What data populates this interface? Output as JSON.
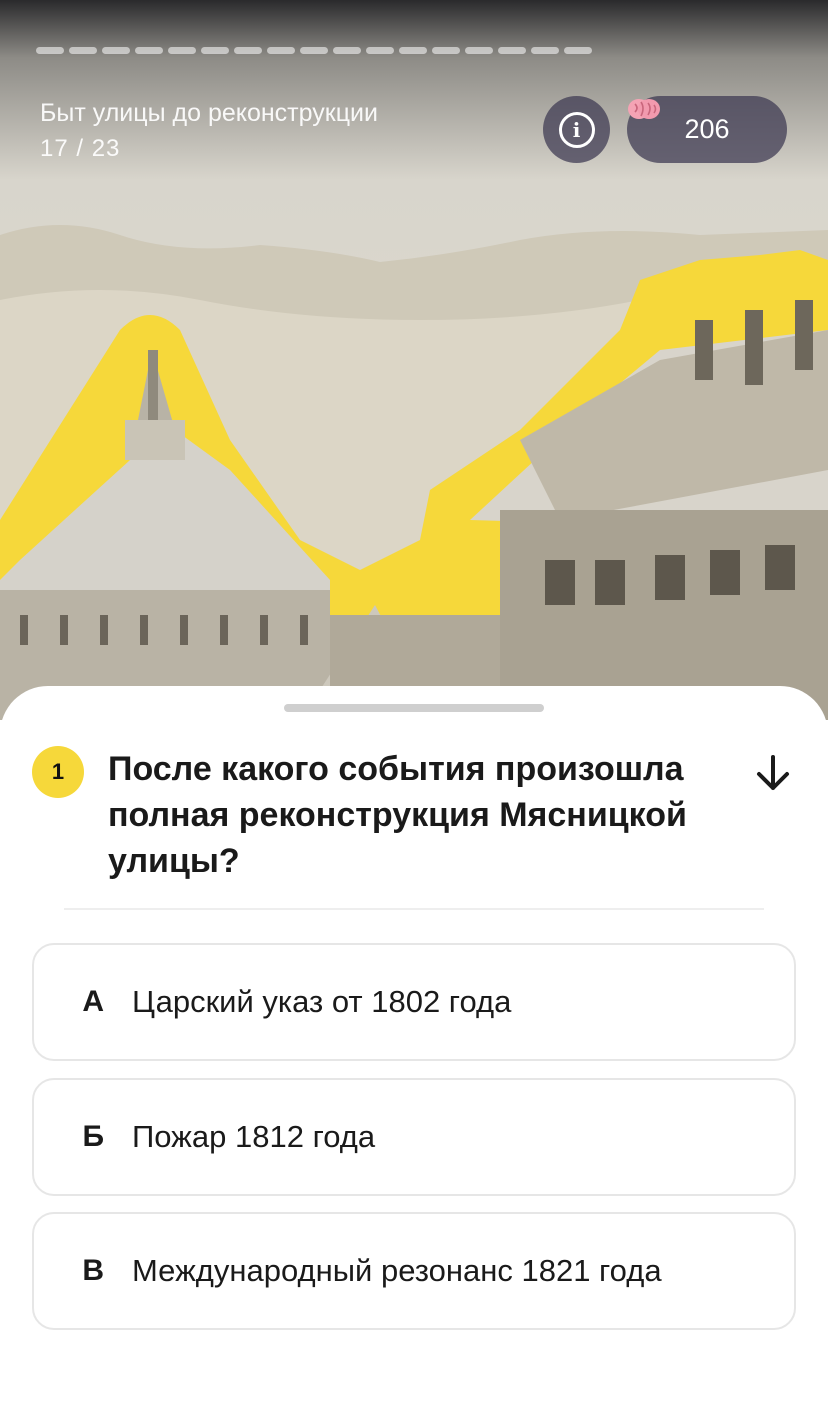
{
  "story": {
    "title": "Быт улицы до реконструкции",
    "counter": "17 / 23",
    "progress_total": 17
  },
  "header": {
    "info_icon": "info-icon",
    "score_icon": "brain-icon",
    "score": "206"
  },
  "question": {
    "number": "1",
    "text": "После какого события произошла полная реконструкция Мясницкой улицы?",
    "collapse_icon": "arrow-down-icon"
  },
  "answers": [
    {
      "letter": "А",
      "text": "Царский указ от 1802 года"
    },
    {
      "letter": "Б",
      "text": "Пожар 1812 года"
    },
    {
      "letter": "В",
      "text": "Международный резонанс 1821 года"
    }
  ],
  "colors": {
    "accent_yellow": "#f6d83a",
    "pill_bg": "#3c3750"
  }
}
